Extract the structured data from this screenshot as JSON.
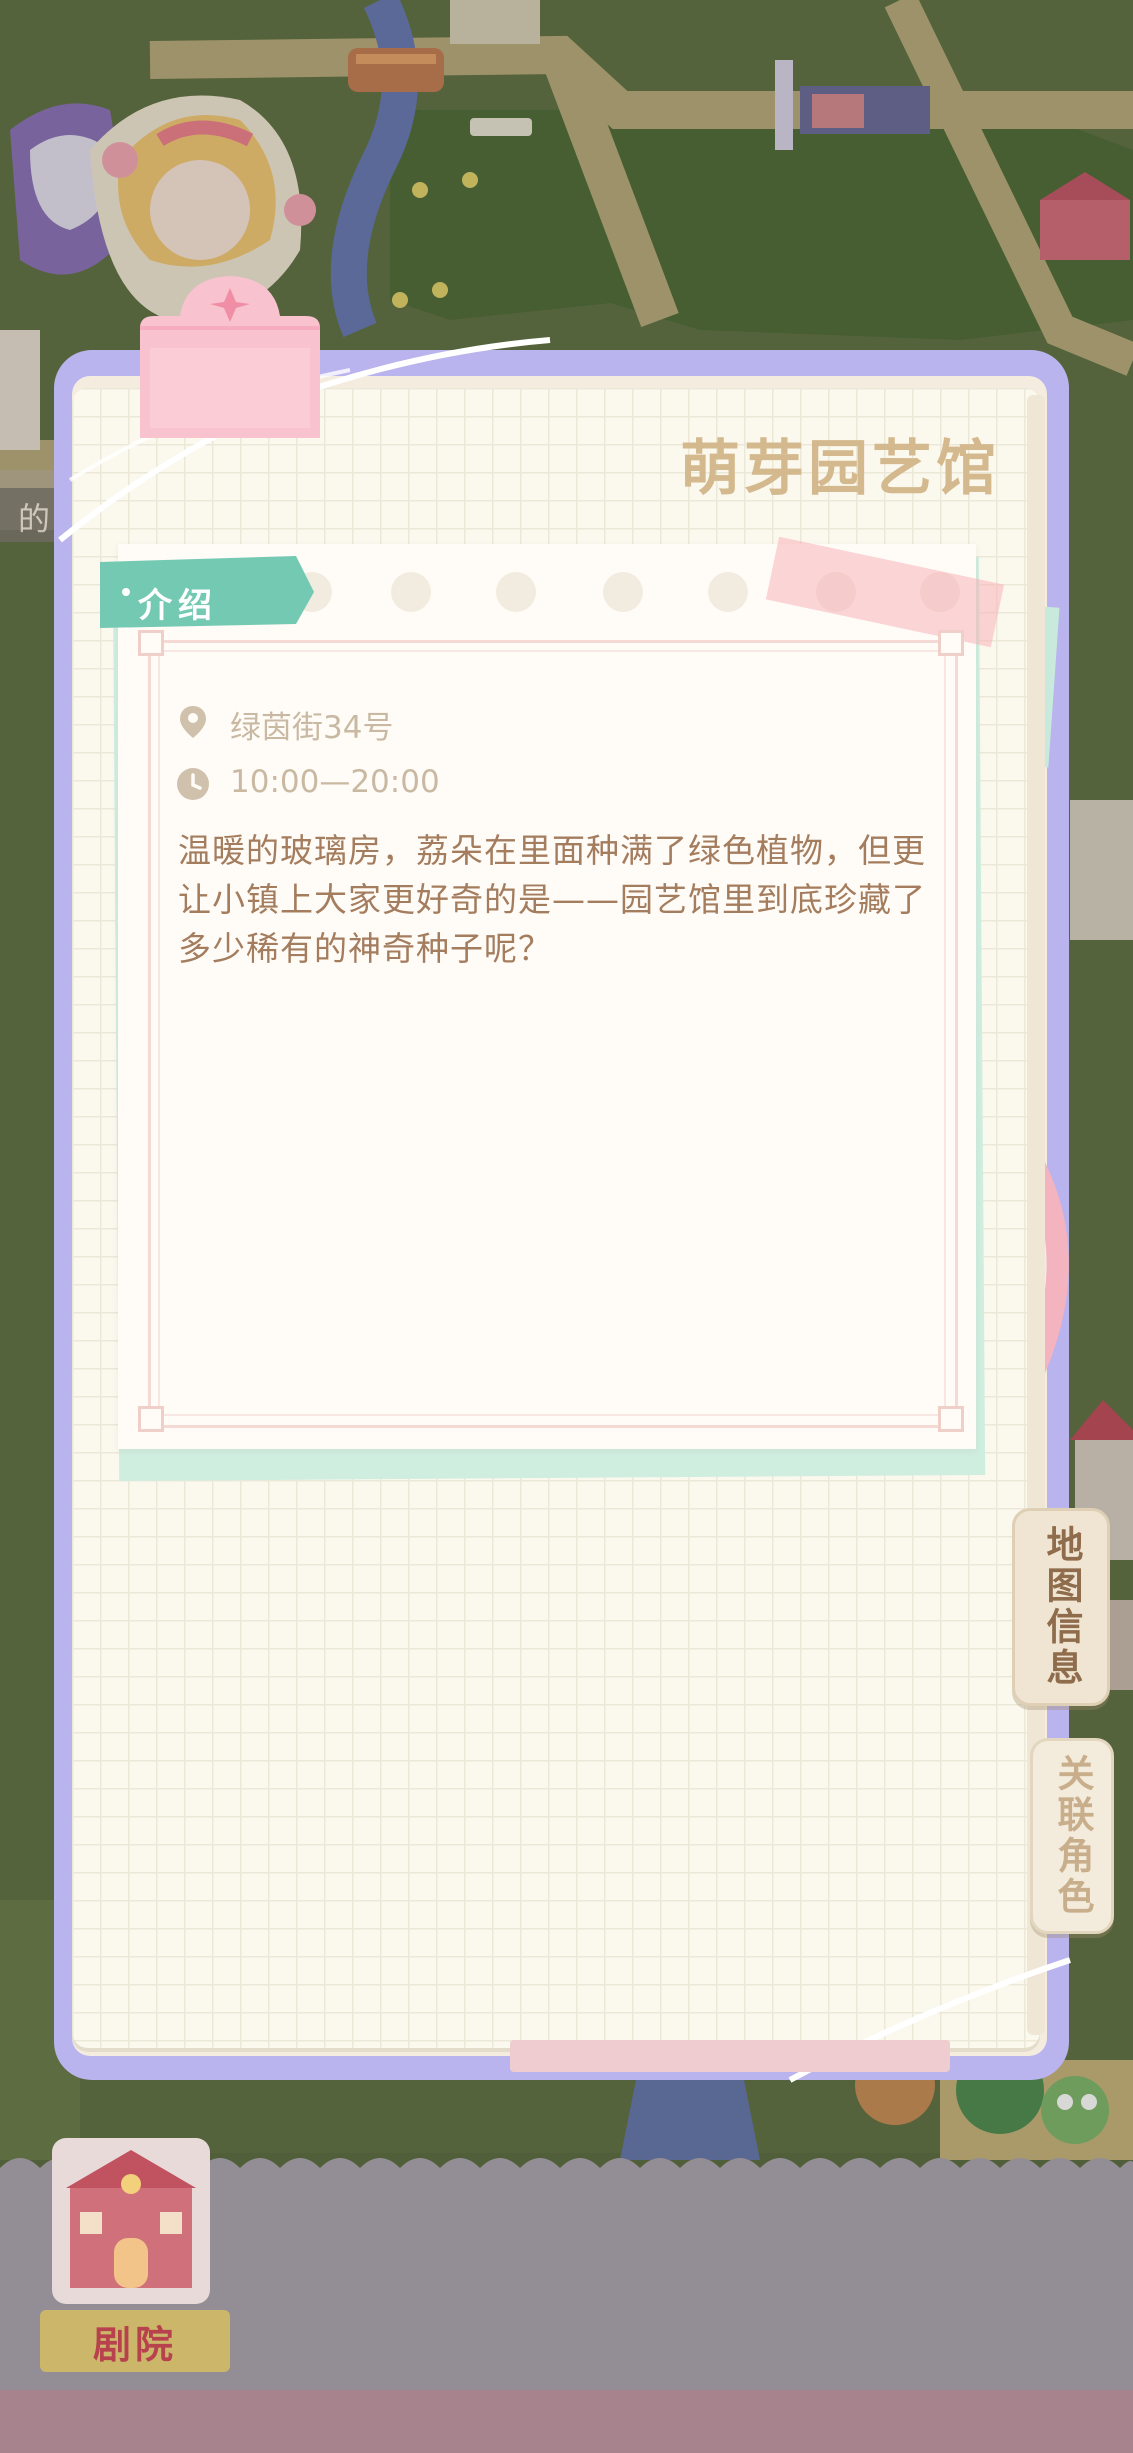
{
  "panel": {
    "title": "萌芽园艺馆",
    "intro_tab": "介绍",
    "address": "绿茵街34号",
    "hours": "10:00—20:00",
    "description": "温暖的玻璃房，荔朵在里面种满了绿色植物，但更让小镇上大家更好奇的是——园艺馆里到底珍藏了多少稀有的神奇种子呢？"
  },
  "side_tabs": {
    "map_info": "地图信息",
    "related_roles": "关联角色"
  },
  "bottom": {
    "location_label": "剧院"
  },
  "background_labels": {
    "left_edge_fragment": "的"
  },
  "colors": {
    "title": "#d4b98e",
    "intro_tab": "#74c9b2",
    "description": "#a47c5e",
    "book_border": "#b9b3ee"
  },
  "icons": [
    "location-pin-icon",
    "clock-icon",
    "sparkle-icon"
  ]
}
